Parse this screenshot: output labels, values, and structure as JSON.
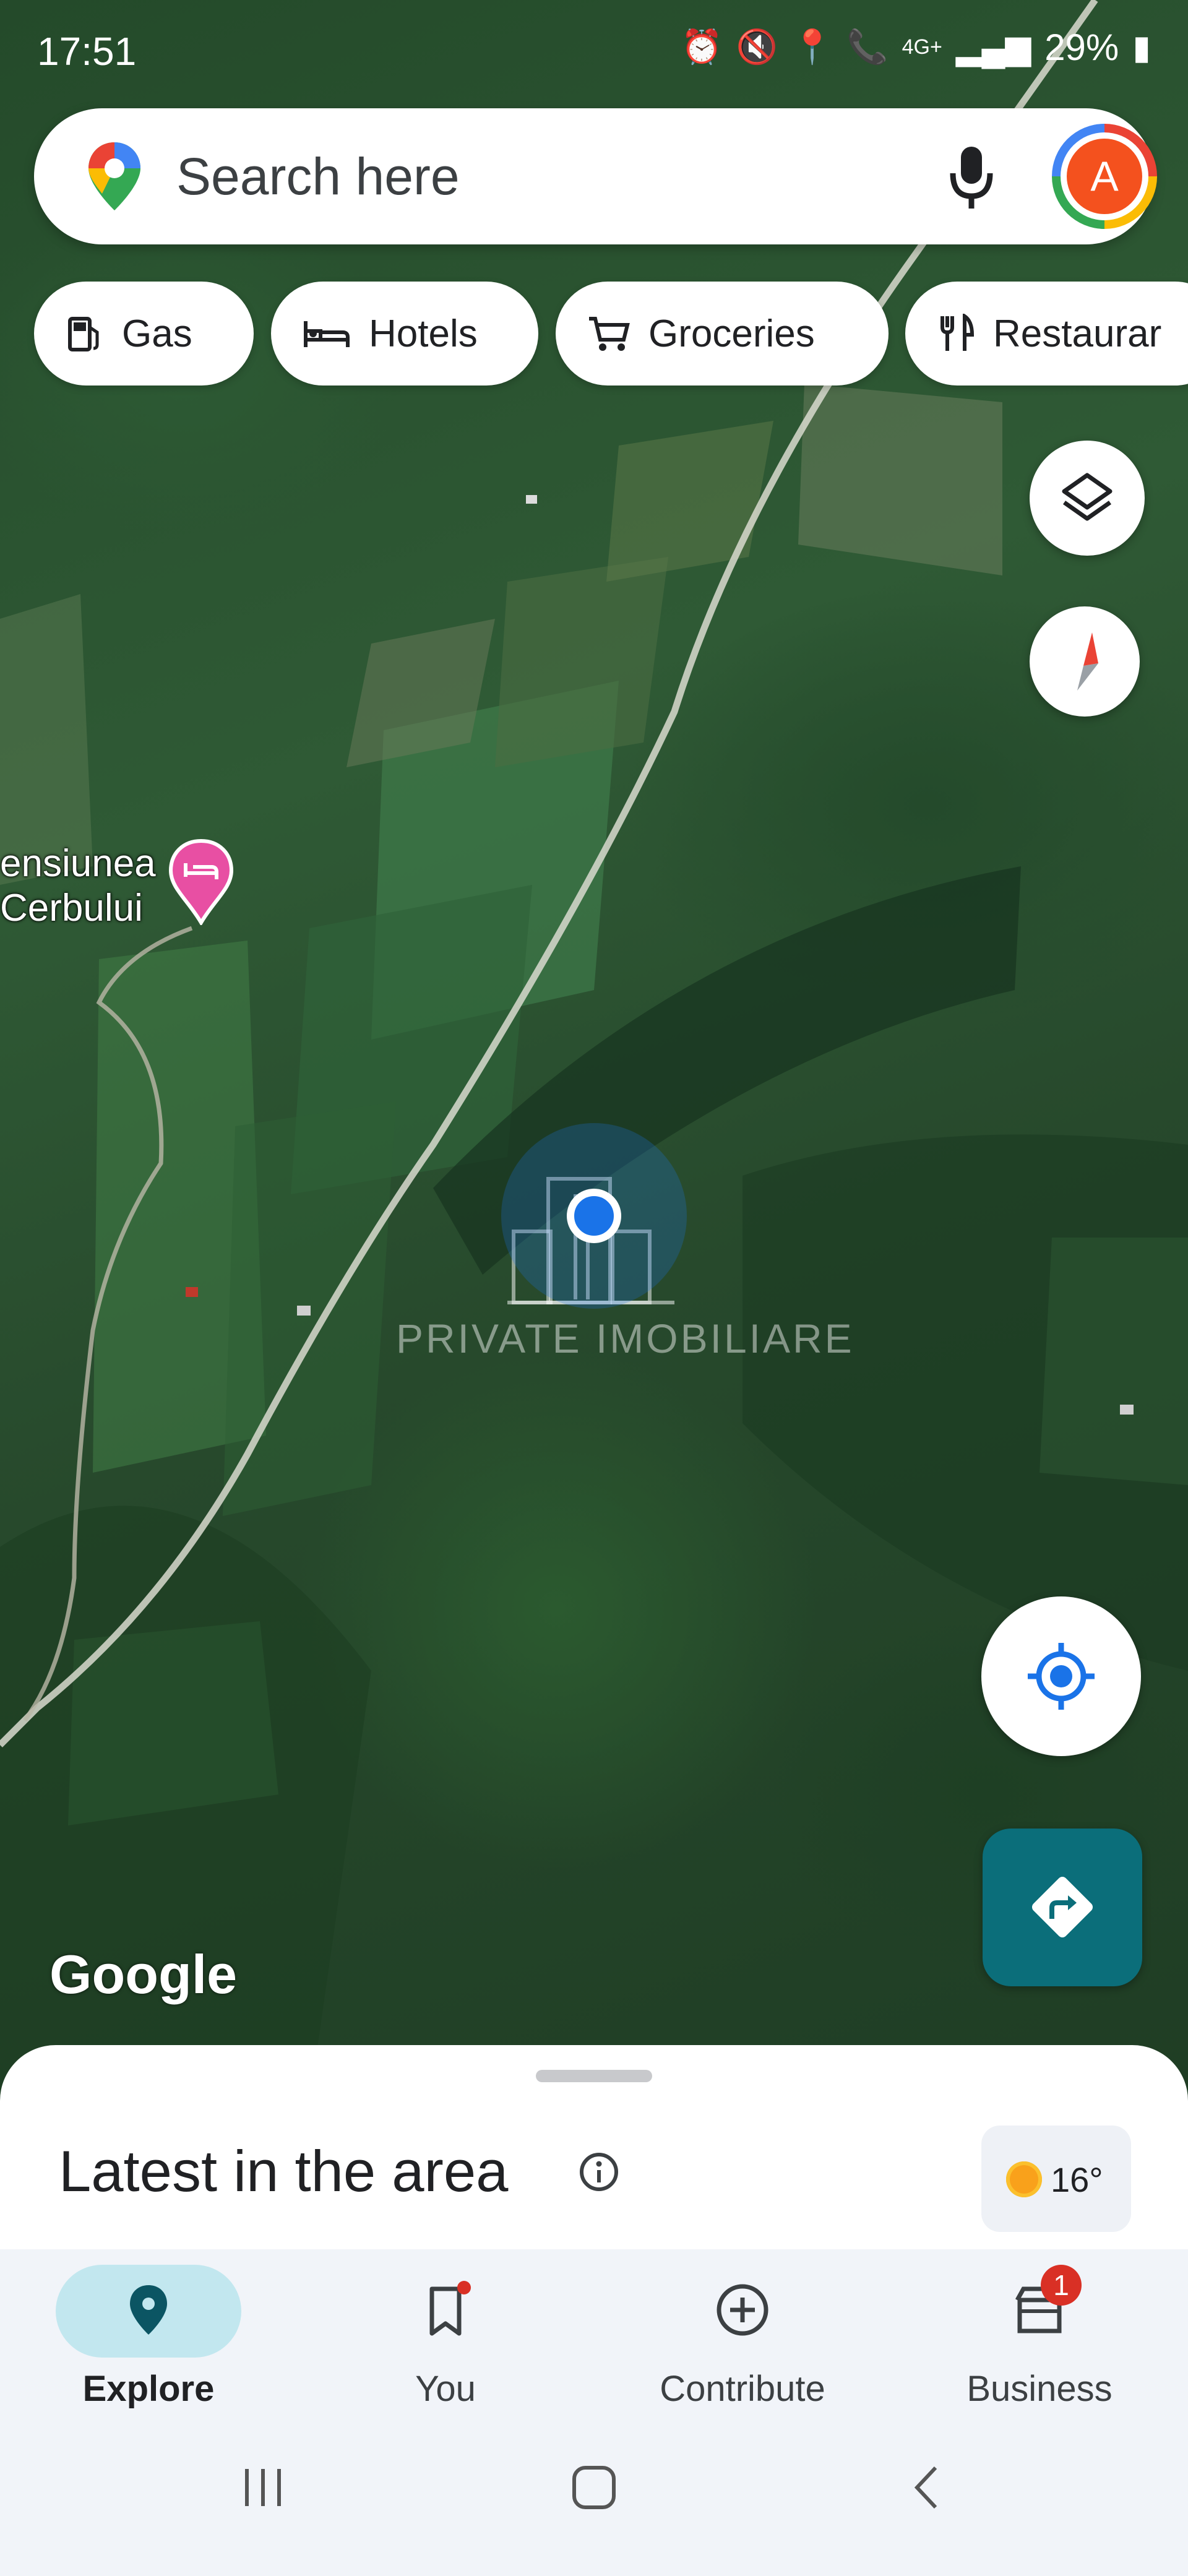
{
  "status_bar": {
    "time": "17:51",
    "battery": "29%",
    "network": "4G+"
  },
  "search": {
    "placeholder": "Search here",
    "avatar_letter": "A"
  },
  "chips": [
    {
      "label": "Gas",
      "icon": "gas-station-icon"
    },
    {
      "label": "Hotels",
      "icon": "bed-icon"
    },
    {
      "label": "Groceries",
      "icon": "cart-icon"
    },
    {
      "label": "Restaurar",
      "icon": "fork-knife-icon"
    }
  ],
  "map": {
    "poi": {
      "line1": "ensiunea",
      "line2": "Cerbului"
    },
    "watermark": "PRIVATE IMOBILIARE",
    "attribution": "Google"
  },
  "bottom_sheet": {
    "title": "Latest in the area",
    "temperature": "16°"
  },
  "bottom_nav": [
    {
      "label": "Explore",
      "active": true
    },
    {
      "label": "You",
      "active": false
    },
    {
      "label": "Contribute",
      "active": false
    },
    {
      "label": "Business",
      "active": false,
      "badge": "1"
    }
  ],
  "colors": {
    "accent": "#0b6e7a",
    "explore_pill": "#c2e7ef",
    "poi": "#e84fa3",
    "location": "#1a73e8"
  }
}
